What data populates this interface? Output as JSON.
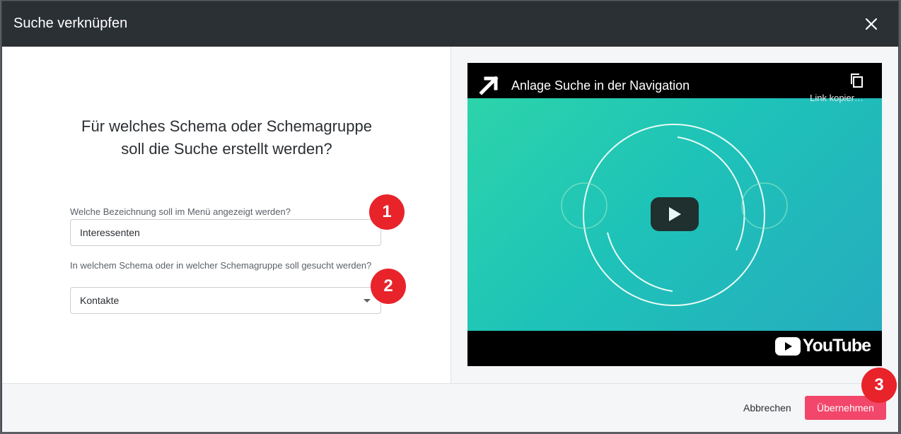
{
  "dialog": {
    "title": "Suche verknüpfen",
    "question": "Für welches Schema oder Schemagruppe soll die Suche erstellt werden?",
    "menu_label": "Welche Bezeichnung soll im Menü angezeigt werden?",
    "menu_value": "Interessenten",
    "schema_label": "In welchem Schema oder in welcher Schemagruppe soll gesucht werden?",
    "schema_value": "Kontakte",
    "badges": [
      "1",
      "2",
      "3"
    ]
  },
  "video": {
    "title": "Anlage Suche in der Navigation",
    "copy_label": "Link kopier…",
    "brand": "YouTube"
  },
  "footer": {
    "cancel_label": "Abbrechen",
    "ok_label": "Übernehmen"
  },
  "colors": {
    "header_bg": "#2b3035",
    "accent": "#f2476a",
    "badge": "#e8232a",
    "video_teal": "#1ec3b8"
  }
}
